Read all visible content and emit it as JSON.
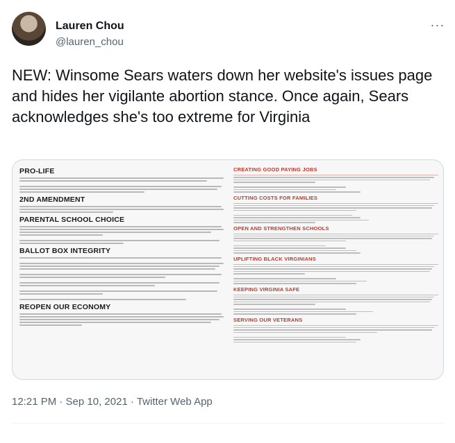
{
  "author": {
    "display_name": "Lauren Chou",
    "handle": "@lauren_chou"
  },
  "tweet": {
    "text": "NEW: Winsome Sears waters down her website's issues page and hides her vigilante abortion stance. Once again, Sears acknowledges she's too extreme for Virginia",
    "timestamp": "12:21 PM · Sep 10, 2021 · Twitter Web App",
    "more_glyph": "···"
  },
  "image": {
    "left_headings": [
      "PRO-LIFE",
      "2ND AMENDMENT",
      "PARENTAL SCHOOL CHOICE",
      "BALLOT BOX INTEGRITY",
      "REOPEN OUR ECONOMY"
    ],
    "right_headings": [
      "CREATING GOOD PAYING JOBS",
      "CUTTING COSTS FOR FAMILIES",
      "OPEN AND STRENGTHEN SCHOOLS",
      "UPLIFTING BLACK VIRGINIANS",
      "KEEPING VIRGINIA SAFE",
      "SERVING OUR VETERANS"
    ],
    "colors": {
      "right_heading": "#c0392b",
      "left_heading": "#1a1a1a"
    }
  }
}
